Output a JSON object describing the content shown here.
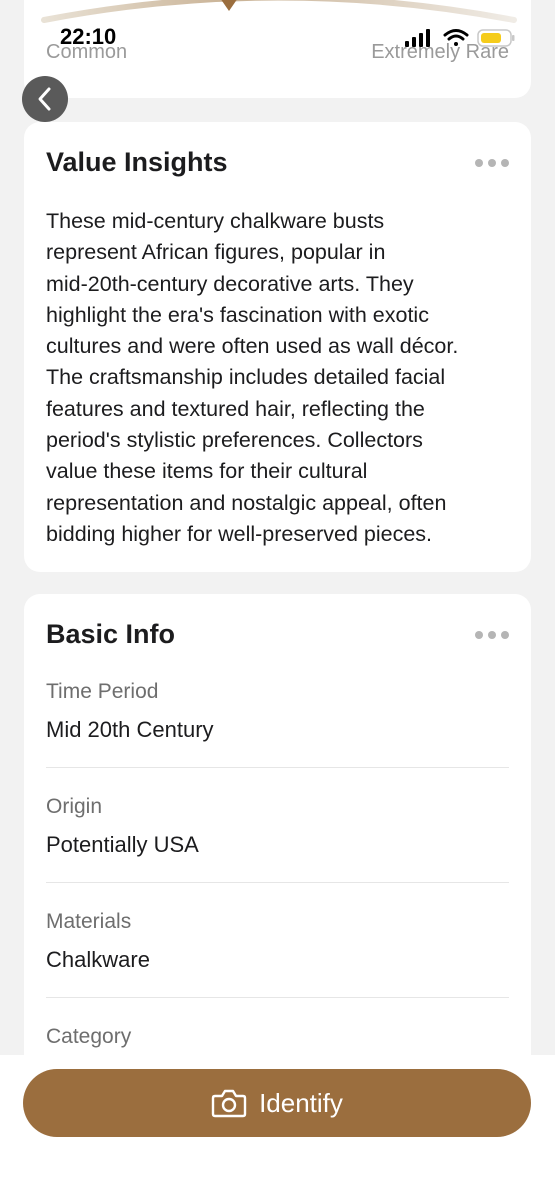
{
  "status_bar": {
    "time": "22:10"
  },
  "rarity": {
    "low_label": "Common",
    "high_label": "Extremely Rare"
  },
  "value_insights": {
    "title": "Value Insights",
    "lines": [
      "These mid-century chalkware busts",
      "represent African figures, popular in",
      "mid-20th-century decorative arts. They",
      "highlight the era's fascination with exotic",
      "cultures and were often used as wall décor.",
      "The craftsmanship includes detailed facial",
      "features and textured hair, reflecting the",
      "period's stylistic preferences. Collectors",
      "value these items for their cultural",
      "representation and nostalgic appeal, often",
      "bidding higher for well-preserved pieces."
    ]
  },
  "basic_info": {
    "title": "Basic Info",
    "rows": [
      {
        "label": "Time Period",
        "value": "Mid 20th Century"
      },
      {
        "label": "Origin",
        "value": "Potentially USA"
      },
      {
        "label": "Materials",
        "value": "Chalkware"
      },
      {
        "label": "Category",
        "value": ""
      }
    ]
  },
  "identify_button": {
    "label": "Identify"
  },
  "colors": {
    "accent": "#9b6e3e",
    "background": "#f2f2f2",
    "card": "#ffffff"
  },
  "icons": {
    "back": "chevron-left-icon",
    "more": "more-dots-icon",
    "camera": "camera-icon"
  }
}
